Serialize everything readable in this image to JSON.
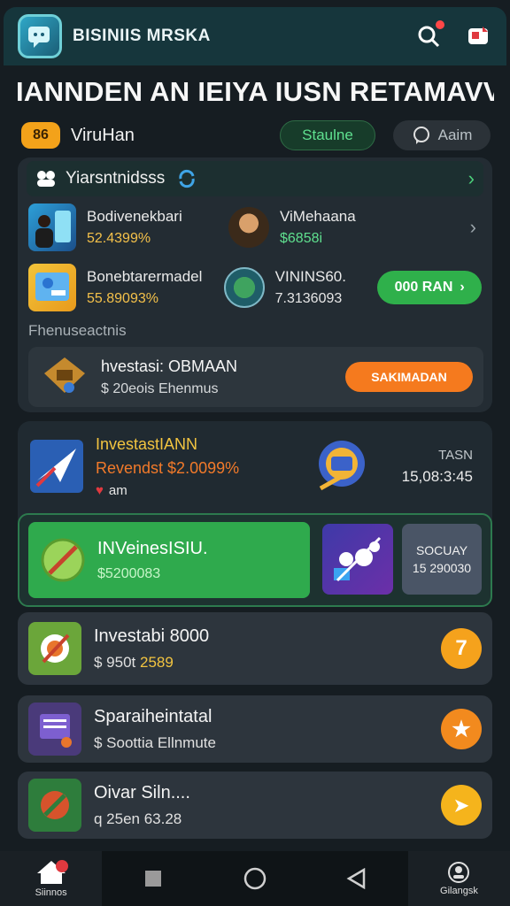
{
  "header": {
    "app_title": "BISINIIS MRSKA",
    "icons": [
      "search-icon",
      "notification-icon"
    ],
    "colors": {
      "bar": "#16363c",
      "accent_red": "#ff4747"
    }
  },
  "headline": "IANNDEN AN IEIYA IUSN RETAMAVV",
  "user": {
    "badge": "86",
    "name": "ViruHan",
    "status_label": "Staulne",
    "alert_label": "Aaim"
  },
  "panel": {
    "title": "Yiarsntnidsss",
    "rows": [
      {
        "name": "Bodivenekbari",
        "value": "52.4399%",
        "other_name": "ViMehaana",
        "other_value": "$6858i"
      },
      {
        "name": "Bonebtarermadel",
        "value": "55.89093%",
        "other_name": "VININS60.",
        "other_value": "7.3136093",
        "button": "000 RAN"
      }
    ],
    "section_label": "Fhenuseactnis",
    "invest": {
      "title": "hvestasi: OBMAAN",
      "sub": "$ 20eois Ehenmus",
      "button": "SAKIMADAN"
    }
  },
  "card2": {
    "title": "InvestastIANN",
    "sub": "Revendst $2.0099%",
    "tiny": "am",
    "right_a": "TASN",
    "right_b": "15,08:3:45",
    "featured": {
      "title": "INVeinesISIU.",
      "value": "$5200083",
      "box_a": "SOCUAY",
      "box_b": "15 290030"
    }
  },
  "list": [
    {
      "title": "Investabi 8000",
      "sub_prefix": "$ 950t ",
      "sub_hl": "2589",
      "badge": "7"
    },
    {
      "title": "Sparaiheintatal",
      "sub_prefix": "$ Soottia Ellnmute",
      "sub_hl": "",
      "badge": "★"
    },
    {
      "title": "Oivar Siln....",
      "sub_prefix": "q 25en 63.28",
      "sub_hl": "",
      "badge": "➤"
    }
  ],
  "nav": {
    "home_label": "Siinnos",
    "profile_label": "Gilangsk"
  }
}
